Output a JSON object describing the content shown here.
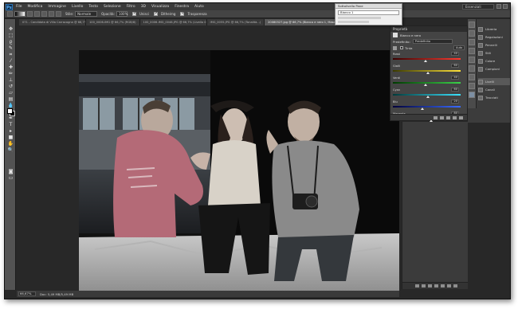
{
  "app": {
    "logo": "Ps",
    "menu": [
      "File",
      "Modifica",
      "Immagine",
      "Livello",
      "Testo",
      "Selezione",
      "Filtro",
      "3D",
      "Visualizza",
      "Finestra",
      "Aiuto"
    ],
    "workspace": "Essenziali"
  },
  "options_bar": {
    "stile_label": "Stile:",
    "stile_value": "Normale",
    "opacita_label": "Opacità:",
    "opacita_value": "100%",
    "check1": "Unisci",
    "check2": "Ditheirng",
    "check3": "Trasparenza"
  },
  "tabs": [
    {
      "label": "071 - Candidata di Villa Carracagna @ 66,7% (RGB/8)",
      "active": false
    },
    {
      "label": "100_0006-IMG @ 66,7% (RGB/8)",
      "active": false
    },
    {
      "label": "100_0006-IMG_0046.JPG @ 66,7% (Livello 0 copia, RGB/8)",
      "active": false
    },
    {
      "label": "IMG_0055.JPG @ 66,7% (Tonalità...)",
      "active": false
    },
    {
      "label": "20080327.jpg @ 66,7% (Bianco e nero 1, Maschera di livello/8) *",
      "active": true
    }
  ],
  "properties_panel": {
    "header": "Proprietà",
    "adjustment_title": "Bianco e nero",
    "preset_label": "Predefinito:",
    "preset_value": "Predefinito",
    "tinta_label": "Tinta",
    "auto_label": "Auto",
    "sliders": [
      {
        "label": "Rossi",
        "value": 40
      },
      {
        "label": "Gialli",
        "value": 60
      },
      {
        "label": "Verdi",
        "value": 40
      },
      {
        "label": "Cyan",
        "value": 60
      },
      {
        "label": "Blu",
        "value": 20
      },
      {
        "label": "Magenta",
        "value": 80
      }
    ]
  },
  "dock": {
    "items": [
      {
        "label": "Libreria",
        "active": false
      },
      {
        "label": "Regolazioni",
        "active": false
      },
      {
        "label": "Pennelli",
        "active": false
      },
      {
        "label": "Stili",
        "active": false
      },
      {
        "label": "Colore",
        "active": false
      },
      {
        "label": "Campioni",
        "active": false
      },
      {
        "label": "Livelli",
        "active": true
      },
      {
        "label": "Canali",
        "active": false
      },
      {
        "label": "Tracciati",
        "active": false
      }
    ]
  },
  "popup": {
    "title": "Sottolivello Pane",
    "field": "Bianco 1"
  },
  "status": {
    "zoom": "66,67%",
    "doc": "Doc: 5,49 MB/5,49 MB"
  },
  "colors": {
    "accent": "#2a72b6",
    "background": "#282828",
    "panel": "#444444"
  }
}
